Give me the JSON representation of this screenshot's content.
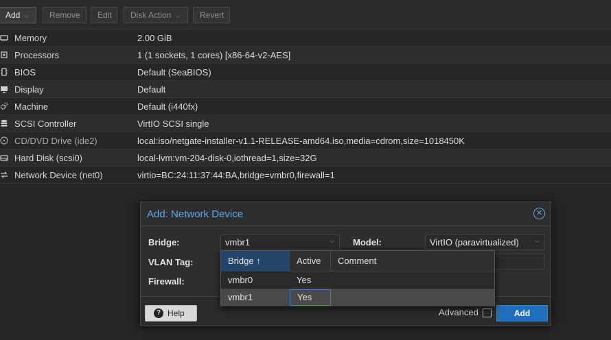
{
  "toolbar": {
    "add_label": "Add",
    "remove_label": "Remove",
    "edit_label": "Edit",
    "disk_action_label": "Disk Action",
    "revert_label": "Revert"
  },
  "hardware": [
    {
      "icon": "memory-icon",
      "key": "Memory",
      "value": "2.00 GiB"
    },
    {
      "icon": "cpu-icon",
      "key": "Processors",
      "value": "1 (1 sockets, 1 cores) [x86-64-v2-AES]"
    },
    {
      "icon": "chip-icon",
      "key": "BIOS",
      "value": "Default (SeaBIOS)"
    },
    {
      "icon": "monitor-icon",
      "key": "Display",
      "value": "Default"
    },
    {
      "icon": "cogs-icon",
      "key": "Machine",
      "value": "Default (i440fx)"
    },
    {
      "icon": "database-icon",
      "key": "SCSI Controller",
      "value": "VirtIO SCSI single"
    },
    {
      "icon": "disc-icon",
      "key": "CD/DVD Drive (ide2)",
      "value": "local:iso/netgate-installer-v1.1-RELEASE-amd64.iso,media=cdrom,size=1018450K"
    },
    {
      "icon": "hdd-icon",
      "key": "Hard Disk (scsi0)",
      "value": "local-lvm:vm-204-disk-0,iothread=1,size=32G"
    },
    {
      "icon": "network-icon",
      "key": "Network Device (net0)",
      "value": "virtio=BC:24:11:37:44:BA,bridge=vmbr0,firewall=1"
    }
  ],
  "dialog": {
    "title": "Add: Network Device",
    "bridge_label": "Bridge:",
    "bridge_value": "vmbr1",
    "vlan_label": "VLAN Tag:",
    "firewall_label": "Firewall:",
    "model_label": "Model:",
    "model_value": "VirtIO (paravirtualized)",
    "help_label": "Help",
    "advanced_label": "Advanced",
    "add_label": "Add"
  },
  "bridge_grid": {
    "columns": [
      "Bridge ↑",
      "Active",
      "Comment"
    ],
    "rows": [
      {
        "bridge": "vmbr0",
        "active": "Yes",
        "comment": ""
      },
      {
        "bridge": "vmbr1",
        "active": "Yes",
        "comment": ""
      }
    ]
  },
  "colors": {
    "accent": "#5fa8e8",
    "primary_button": "#1f6fbd",
    "sorted_header": "#23456a"
  }
}
